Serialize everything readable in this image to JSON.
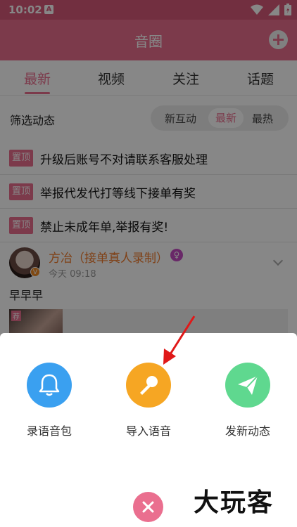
{
  "status_bar": {
    "time": "10:02",
    "notification_letter": "A"
  },
  "header": {
    "title": "音圈"
  },
  "tabs": [
    {
      "label": "最新",
      "active": true
    },
    {
      "label": "视频",
      "active": false
    },
    {
      "label": "关注",
      "active": false
    },
    {
      "label": "话题",
      "active": false
    }
  ],
  "filter": {
    "label": "筛选动态",
    "options": [
      "新互动",
      "最新",
      "最热"
    ],
    "selected": "最新"
  },
  "pinned": [
    {
      "tag": "置顶",
      "text": "升级后账号不对请联系客服处理"
    },
    {
      "tag": "置顶",
      "text": "举报代发代打等线下接单有奖"
    },
    {
      "tag": "置顶",
      "text": "禁止未成年单,举报有奖!"
    }
  ],
  "post": {
    "name": "方冶（接单真人录制）",
    "time": "今天 09:18",
    "text": "早早早",
    "media_tag": "荐",
    "verified_badge": "V"
  },
  "sheet": {
    "actions": [
      {
        "label": "录语音包",
        "icon": "bell-icon",
        "color": "#3aa0f0"
      },
      {
        "label": "导入语音",
        "icon": "microphone-icon",
        "color": "#f6a623"
      },
      {
        "label": "发新动态",
        "icon": "paper-plane-icon",
        "color": "#5fd88f"
      }
    ]
  },
  "colors": {
    "accent": "#ea6f8f",
    "status_bar": "#d85a7a"
  },
  "watermark": "大玩客"
}
